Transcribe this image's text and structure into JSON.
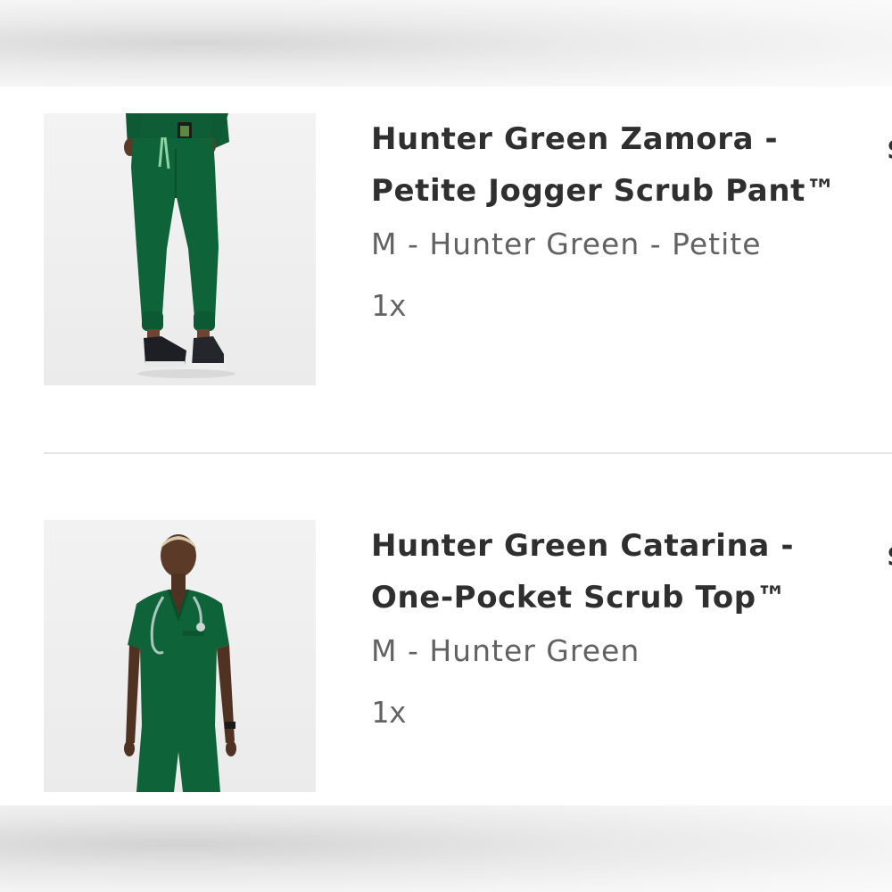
{
  "cart": {
    "items": [
      {
        "title": "Hunter Green Zamora -\nPetite Jogger Scrub Pant™",
        "variant": "M - Hunter Green - Petite",
        "quantity": "1x",
        "price_fragment": "$",
        "image_icon": "jogger-pant-image"
      },
      {
        "title": "Hunter Green Catarina -\nOne-Pocket Scrub Top™",
        "variant": "M - Hunter Green",
        "quantity": "1x",
        "price_fragment": "$",
        "image_icon": "scrub-top-image"
      }
    ]
  },
  "colors": {
    "product_green": "#10633a",
    "title_text": "#2f2f2f",
    "secondary_text": "#626262",
    "divider": "#e6e6e6"
  }
}
